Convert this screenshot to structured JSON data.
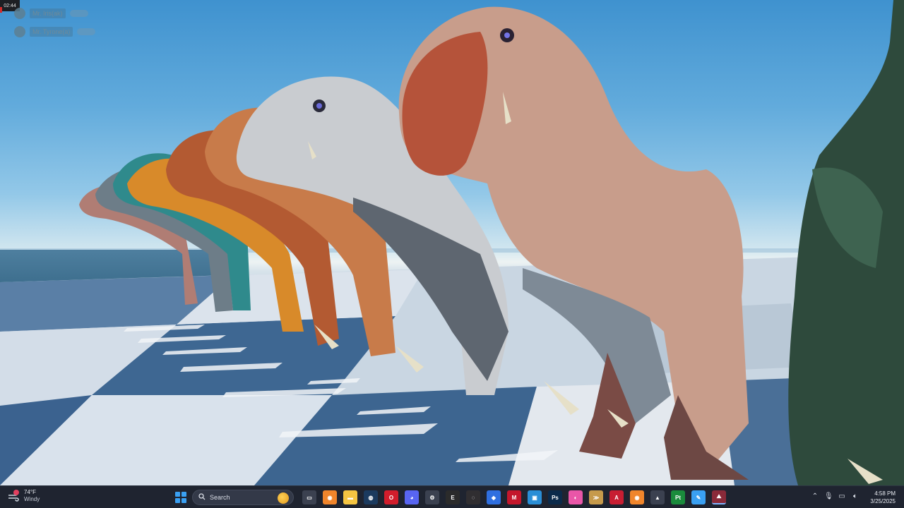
{
  "overlay": {
    "recording_time": "02:44",
    "players": [
      {
        "name": "Mr. Iris(ak)"
      },
      {
        "name": "Mr. Tyrone(a)"
      }
    ]
  },
  "taskbar": {
    "weather": {
      "temperature": "74°F",
      "condition": "Windy",
      "badge_color": "#e2405f"
    },
    "search": {
      "label": "Search"
    },
    "apps": [
      {
        "name": "task-view-icon",
        "glyph": "▭",
        "color": "#3b4150"
      },
      {
        "name": "blender-icon",
        "glyph": "◉",
        "color": "#f0852b"
      },
      {
        "name": "file-explorer-icon",
        "glyph": "▬",
        "color": "#f5c542"
      },
      {
        "name": "steam-icon",
        "glyph": "◍",
        "color": "#1b3a5e"
      },
      {
        "name": "opera-icon",
        "glyph": "O",
        "color": "#d11d2c"
      },
      {
        "name": "discord-icon",
        "glyph": "◕",
        "color": "#5865f2"
      },
      {
        "name": "settings-gear-icon",
        "glyph": "⚙",
        "color": "#3b4150"
      },
      {
        "name": "epic-games-icon",
        "glyph": "E",
        "color": "#2b2b2b"
      },
      {
        "name": "obs-icon",
        "glyph": "◌",
        "color": "#302e31"
      },
      {
        "name": "shield-app-icon",
        "glyph": "◆",
        "color": "#2f6fe0"
      },
      {
        "name": "mail-app-icon",
        "glyph": "M",
        "color": "#c4172c"
      },
      {
        "name": "image-viewer-icon",
        "glyph": "▣",
        "color": "#2a8ed6"
      },
      {
        "name": "photoshop-icon",
        "glyph": "Ps",
        "color": "#0b2a4a"
      },
      {
        "name": "paint-app-icon",
        "glyph": "◐",
        "color": "#e956a8"
      },
      {
        "name": "wing-app-icon",
        "glyph": "≫",
        "color": "#c69a4b"
      },
      {
        "name": "ark-app-icon",
        "glyph": "A",
        "color": "#c81e32"
      },
      {
        "name": "blender-alt-icon",
        "glyph": "◉",
        "color": "#f0852b"
      },
      {
        "name": "dev-kit-icon",
        "glyph": "▲",
        "color": "#3b4150"
      },
      {
        "name": "pycharm-icon",
        "glyph": "Pt",
        "color": "#1a8b3c"
      },
      {
        "name": "notes-app-icon",
        "glyph": "✎",
        "color": "#3aa0f2"
      },
      {
        "name": "ark-dev-kit-icon",
        "glyph": "⛰",
        "color": "#8a2a39"
      }
    ],
    "tray": {
      "icons": [
        "chevron-up-icon",
        "microphone-icon",
        "network-icon",
        "volume-icon"
      ]
    },
    "clock": {
      "time": "4:58 PM",
      "date": "3/25/2025"
    }
  },
  "colors": {
    "sky_top": "#3f92cf",
    "floor_dark": "#3a5f8f",
    "floor_light": "#dfe6ee",
    "taskbar": "#1f2430"
  }
}
